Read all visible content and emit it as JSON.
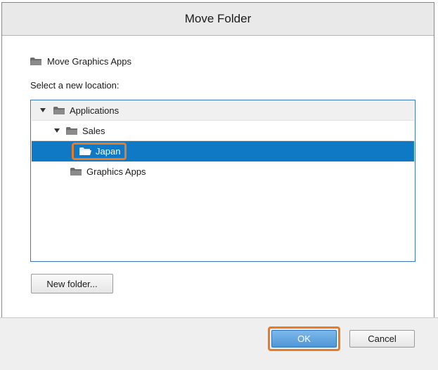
{
  "dialog": {
    "title": "Move Folder"
  },
  "subject": {
    "label": "Move Graphics Apps",
    "icon": "folder-icon"
  },
  "prompt": "Select a new location:",
  "tree": {
    "root": {
      "label": "Applications",
      "expanded": true
    },
    "sales": {
      "label": "Sales",
      "expanded": true
    },
    "japan": {
      "label": "Japan",
      "selected": true
    },
    "graphics": {
      "label": "Graphics Apps"
    }
  },
  "buttons": {
    "new_folder": "New folder...",
    "ok": "OK",
    "cancel": "Cancel"
  },
  "colors": {
    "selection": "#0f79c5",
    "highlight": "#ea7b22",
    "tree_border": "#3b78c6"
  }
}
